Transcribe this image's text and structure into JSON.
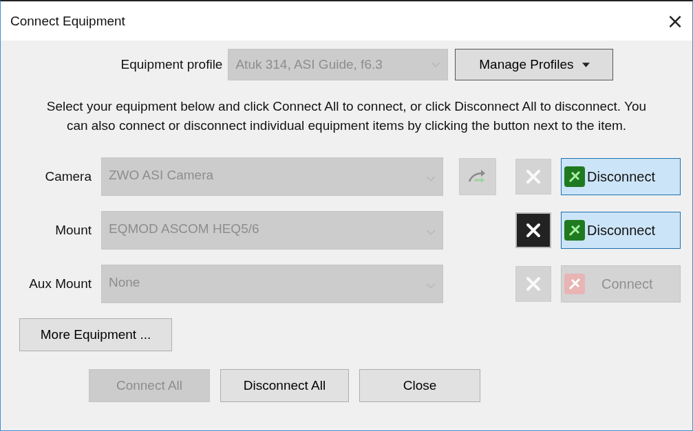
{
  "window": {
    "title": "Connect Equipment",
    "close": "×"
  },
  "profile": {
    "label": "Equipment profile",
    "value": "Atuk 314, ASI Guide, f6.3",
    "disabled": true,
    "manage_button": "Manage Profiles"
  },
  "instructions": "Select your equipment below and click Connect All to connect, or click Disconnect All to disconnect. You can also connect or disconnect individual equipment items by clicking the button next to the item.",
  "equipment": [
    {
      "label": "Camera",
      "value": "ZWO ASI Camera",
      "swap_button": {
        "disabled": true
      },
      "setup_enabled": false,
      "connected": true,
      "connect_enabled": true,
      "connect_label": "Disconnect"
    },
    {
      "label": "Mount",
      "value": "EQMOD ASCOM HEQ5/6",
      "setup_enabled": true,
      "connected": true,
      "connect_enabled": true,
      "connect_label": "Disconnect"
    },
    {
      "label": "Aux Mount",
      "value": "None",
      "setup_enabled": false,
      "connected": false,
      "connect_enabled": false,
      "connect_label": "Connect"
    }
  ],
  "more_button": "More Equipment ...",
  "buttons": [
    {
      "label": "Connect All",
      "disabled": true
    },
    {
      "label": "Disconnect All",
      "disabled": false
    },
    {
      "label": "Close",
      "disabled": false
    }
  ]
}
